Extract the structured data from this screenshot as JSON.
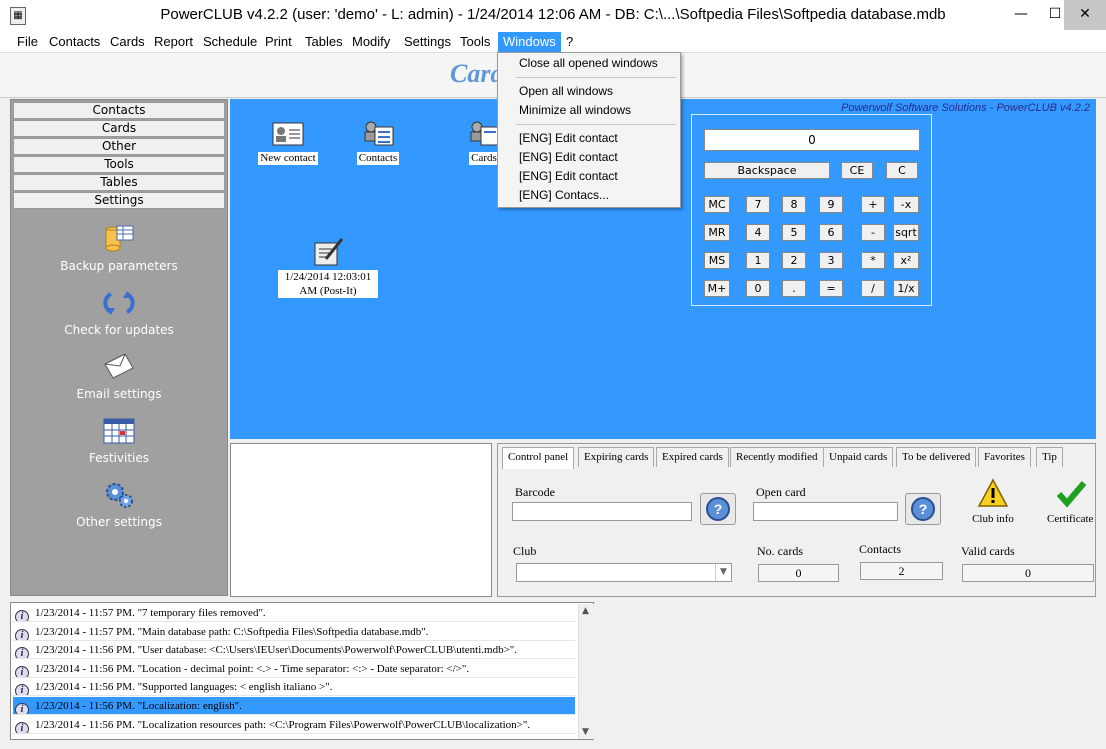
{
  "window": {
    "title": "PowerCLUB v4.2.2  (user: 'demo'  - L: admin) - 1/24/2014 12:06 AM - DB: C:\\...\\Softpedia Files\\Softpedia database.mdb",
    "minimize": "—",
    "maximize": "☐",
    "close": "✕"
  },
  "menubar": {
    "items": [
      "File",
      "Contacts",
      "Cards",
      "Report",
      "Schedule",
      "Print",
      "Tables",
      "Modify",
      "Settings",
      "Tools",
      "Windows",
      "?"
    ],
    "active": "Windows"
  },
  "toolbar": {
    "logo": "Card"
  },
  "windows_menu": {
    "items": [
      "Close all opened windows",
      "Open all windows",
      "Minimize all windows",
      "[ENG] Edit contact",
      "[ENG] Edit contact",
      "[ENG] Edit contact",
      "[ENG] Contacs..."
    ]
  },
  "sidebar": {
    "tabs": [
      "Contacts",
      "Cards",
      "Other",
      "Tools",
      "Tables",
      "Settings"
    ],
    "items": [
      {
        "label": "Backup parameters",
        "icon": "database-backup-icon"
      },
      {
        "label": "Check for updates",
        "icon": "refresh-icon"
      },
      {
        "label": "Email settings",
        "icon": "envelope-icon"
      },
      {
        "label": "Festivities",
        "icon": "calendar-icon"
      },
      {
        "label": "Other settings",
        "icon": "gears-icon"
      }
    ]
  },
  "desktop": {
    "brand": "Powerwolf Software Solutions - PowerCLUB v4.2.2",
    "icons": [
      {
        "label": "New contact",
        "icon": "id-card-icon"
      },
      {
        "label": "Contacts",
        "icon": "contacts-icon"
      },
      {
        "label": "Cards",
        "icon": "cards-icon"
      },
      {
        "label": "1/24/2014 12:03:01 AM (Post-It)",
        "icon": "note-pencil-icon"
      }
    ],
    "accent": "#3399ff"
  },
  "calculator": {
    "display": "0",
    "top_row": [
      "Backspace",
      "CE",
      "C"
    ],
    "rows": [
      [
        "MC",
        "7",
        "8",
        "9",
        "+",
        "-x"
      ],
      [
        "MR",
        "4",
        "5",
        "6",
        "-",
        "sqrt"
      ],
      [
        "MS",
        "1",
        "2",
        "3",
        "*",
        "x²"
      ],
      [
        "M+",
        "0",
        ".",
        "=",
        "/",
        "1/x"
      ]
    ]
  },
  "control_panel": {
    "tabs": [
      "Control panel",
      "Expiring cards",
      "Expired cards",
      "Recently modified",
      "Unpaid cards",
      "To be delivered",
      "Favorites",
      "Tip"
    ],
    "active_tab": "Control panel",
    "barcode_label": "Barcode",
    "barcode_value": "",
    "open_card_label": "Open card",
    "open_card_value": "",
    "club_info_label": "Club info",
    "certificate_label": "Certificate",
    "club_label": "Club",
    "club_value": "",
    "no_cards_label": "No. cards",
    "no_cards_value": "0",
    "contacts_label": "Contacts",
    "contacts_value": "2",
    "valid_cards_label": "Valid cards",
    "valid_cards_value": "0"
  },
  "log": {
    "entries": [
      "1/23/2014 - 11:57 PM. \"7 temporary files removed\".",
      "1/23/2014 - 11:57 PM. \"Main database path: C:\\Softpedia Files\\Softpedia database.mdb\".",
      "1/23/2014 - 11:56 PM. \"User database: <C:\\Users\\IEUser\\Documents\\Powerwolf\\PowerCLUB\\utenti.mdb>\".",
      "1/23/2014 - 11:56 PM. \"Location - decimal point: <.> - Time separator: <:> - Date separator: </>\".",
      "1/23/2014 - 11:56 PM. \"Supported languages: < english italiano >\".",
      "1/23/2014 - 11:56 PM. \"Localization: english\".",
      "1/23/2014 - 11:56 PM. \"Localization resources path: <C:\\Program Files\\Powerwolf\\PowerCLUB\\localization>\"."
    ],
    "selected_index": 5,
    "info_glyph": "i"
  }
}
